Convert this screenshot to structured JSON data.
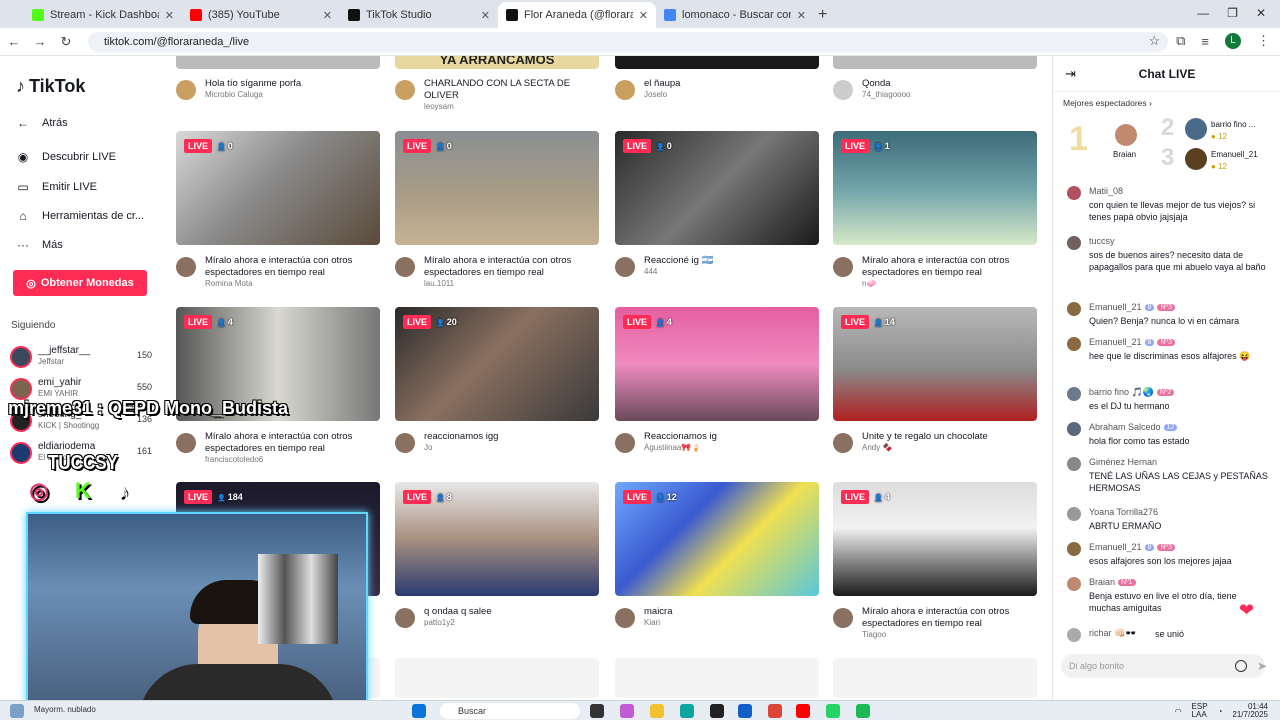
{
  "browser": {
    "tabs": [
      {
        "title": "Stream - Kick Dashboard",
        "color": "#53fc18"
      },
      {
        "title": "(385) YouTube",
        "color": "#ff0000"
      },
      {
        "title": "TikTok Studio",
        "color": "#111111"
      },
      {
        "title": "Flor Araneda (@floraraneda_) en",
        "color": "#111111"
      },
      {
        "title": "lomonaco - Buscar con Google",
        "color": "#4285f4"
      }
    ],
    "url": "tiktok.com/@floraraneda_/live",
    "profile_initial": "L",
    "window_controls": [
      "—",
      "❐",
      "✕"
    ]
  },
  "sidebar": {
    "logo": "TikTok",
    "back": "Atrás",
    "nav": [
      {
        "label": "Descubrir LIVE",
        "icon": "discover-live-icon",
        "glyph": "◉"
      },
      {
        "label": "Emitir LIVE",
        "icon": "camera-icon",
        "glyph": "▭"
      },
      {
        "label": "Herramientas de cr...",
        "icon": "home-tools-icon",
        "glyph": "⌂"
      },
      {
        "label": "Más",
        "icon": "more-icon",
        "glyph": "···"
      }
    ],
    "coins_button": "Obtener Monedas",
    "following_title": "Siguiendo",
    "following": [
      {
        "name": "__jeffstar__",
        "sub": "Jeffstar",
        "count": "150",
        "color": "#3a4a5c"
      },
      {
        "name": "emi_yahir",
        "sub": "EMI YAHIR",
        "count": "550",
        "color": "#7a6650"
      },
      {
        "name": "shooting_",
        "sub": "KICK | Shootingg",
        "count": "136",
        "color": "#222222"
      },
      {
        "name": "eldiariodema",
        "sub": "El diario",
        "count": "161",
        "color": "#1a3a70"
      }
    ]
  },
  "grid": {
    "live_label": "LIVE",
    "top_row": [
      {
        "title": "Hola tío síganme porfa",
        "user": "Microbio Caluga",
        "thumb_text": ""
      },
      {
        "title": "CHARLANDO CON LA SECTA DE OLIVER",
        "user": "leoysam",
        "thumb_text": "YA ARRANCAMOS"
      },
      {
        "title": "el ñaupa",
        "user": "Joselo",
        "thumb_text": ""
      },
      {
        "title": "Qonda",
        "user": "74_thiagoooo",
        "thumb_text": ""
      }
    ],
    "rows": [
      [
        {
          "viewers": "0",
          "title": "Míralo ahora e interactúa con otros espectadores en tiempo real",
          "user": "Romina Mota",
          "bg": "linear-gradient(135deg,#d9d9d9,#8a8a8a 45%,#5a4a3a)"
        },
        {
          "viewers": "0",
          "title": "Míralo ahora e interactúa con otros espectadores en tiempo real",
          "user": "lau.1011",
          "bg": "linear-gradient(180deg,#8a8f93 0%,#a89c86 55%,#c6b394 100%)"
        },
        {
          "viewers": "0",
          "title": "Reaccioné ig 🇦🇷",
          "user": "444",
          "bg": "linear-gradient(135deg,#2a2a2a,#777 50%,#1a1a1a)"
        },
        {
          "viewers": "1",
          "title": "Míralo ahora e interactúa con otros espectadores en tiempo real",
          "user": "n🧼",
          "bg": "linear-gradient(180deg,#3d6b7a 0%,#6fa3a8 50%,#d6e8c8 100%)"
        }
      ],
      [
        {
          "viewers": "4",
          "title": "Míralo ahora e interactúa con otros espectadores en tiempo real",
          "user": "franciscotoledo6",
          "bg": "linear-gradient(90deg,#555 0%,#d8d8d0 50%,#777 100%)"
        },
        {
          "viewers": "20",
          "title": "reaccionamos igg",
          "user": "Jo",
          "bg": "linear-gradient(135deg,#2a2a2a,#8a7060 45%,#3a3a3a)"
        },
        {
          "viewers": "4",
          "title": "Reaccionamos ig",
          "user": "Agustiinaa🎀🍦",
          "bg": "linear-gradient(180deg,#e45fa0 0%,#f08bc0 50%,#6a4a5a 100%)"
        },
        {
          "viewers": "14",
          "title": "Unite y te regalo un chocolate",
          "user": "Andy 🍫",
          "bg": "linear-gradient(180deg,#b8b8b8 0%,#8a8a8a 55%,#b02020 100%)"
        }
      ],
      [
        {
          "viewers": "184",
          "title": "",
          "user": "",
          "bg": "linear-gradient(180deg,#1a1a2a,#3a2a4a)"
        },
        {
          "viewers": "8",
          "title": "q ondaa q salee",
          "user": "patto1y2",
          "bg": "linear-gradient(180deg,#e8e8e8 0%,#a89080 50%,#2a3a70 100%)"
        },
        {
          "viewers": "12",
          "title": "maicra",
          "user": "Kiari",
          "bg": "linear-gradient(135deg,#6fa8ff 0%,#3a5ad0 35%,#f0e050 60%,#58c8d8 100%)"
        },
        {
          "viewers": "4",
          "title": "Míralo ahora e interactúa con otros espectadores en tiempo real",
          "user": "Tiagoo",
          "bg": "linear-gradient(180deg,#dcdcdc 0%,#f2f2f2 40%,#1a1a1a 100%)"
        }
      ]
    ]
  },
  "chat": {
    "title": "Chat LIVE",
    "top_viewers_label": "Mejores espectadores",
    "podium": [
      {
        "rank": "1",
        "name": "Braian",
        "score": "",
        "color": "#c08a70"
      },
      {
        "rank": "2",
        "name": "barrio fino ...",
        "score": "12",
        "color": "#4a6a8a"
      },
      {
        "rank": "3",
        "name": "Emanuell_21",
        "score": "12",
        "color": "#5a4020"
      }
    ],
    "messages": [
      {
        "user": "Matii_08",
        "text": "con quien te llevas mejor de tus viejos? si tenes papá obvio jajsjaja",
        "color": "#b05060",
        "badges": []
      },
      {
        "user": "tuccsy",
        "text": "sos de buenos aires? necesito data de papagallos para que mi abuelo vaya al baño",
        "color": "#706060",
        "badges": []
      },
      {
        "user": "Emanuell_21",
        "text": "Quien? Benja? nunca lo vi en cámara",
        "color": "#8a6a40",
        "badges": [
          "8",
          "Nº3"
        ]
      },
      {
        "user": "Emanuell_21",
        "text": "hee que le discriminas esos alfajores 😝",
        "color": "#8a6a40",
        "badges": [
          "8",
          "Nº3"
        ]
      },
      {
        "user": "barrio fino 🎵🌏",
        "text": "es el DJ tu hermano",
        "color": "#6a7a8a",
        "badges": [
          "Nº2"
        ]
      },
      {
        "user": "Abraham Salcedo",
        "text": "hola flor como tas estado",
        "color": "#5a6a7a",
        "badges": [
          "12"
        ]
      },
      {
        "user": "Giménez Hernan",
        "text": "TENÉ LAS UÑAS LAS CEJAS y PESTAÑAS HERMOSAS",
        "color": "#888888",
        "badges": []
      },
      {
        "user": "Yoana Torrilla276",
        "text": "ABRTU ERMAÑO",
        "color": "#999999",
        "badges": []
      },
      {
        "user": "Emanuell_21",
        "text": "esos alfajores son los mejores jajaa",
        "color": "#8a6a40",
        "badges": [
          "8",
          "Nº3"
        ]
      },
      {
        "user": "Braian",
        "text": "Benja estuvo en live el otro día, tiene muchas amiguitas",
        "color": "#c08a70",
        "badges": [
          "Nº1"
        ]
      },
      {
        "user": "richar 👊🏻🕶️",
        "text": "se unió",
        "color": "#aaaaaa",
        "badges": []
      }
    ],
    "input_placeholder": "Di algo bonito"
  },
  "overlay": {
    "mod_message": "mjreme31 : QEPD Mono_Budista",
    "streamer_tag": "TUCCSY",
    "socials": [
      {
        "name": "instagram-icon",
        "glyph": "◎",
        "color": "#e1306c"
      },
      {
        "name": "kick-icon",
        "glyph": "K",
        "color": "#53fc18"
      },
      {
        "name": "tiktok-icon",
        "glyph": "♪",
        "color": "#ffffff"
      }
    ]
  },
  "taskbar": {
    "weather": "Mayorm. nublado",
    "search_placeholder": "Buscar",
    "lang": "ESP\nLAA",
    "time": "01:44",
    "date": "21/7/2025",
    "notif_count": "99+"
  }
}
